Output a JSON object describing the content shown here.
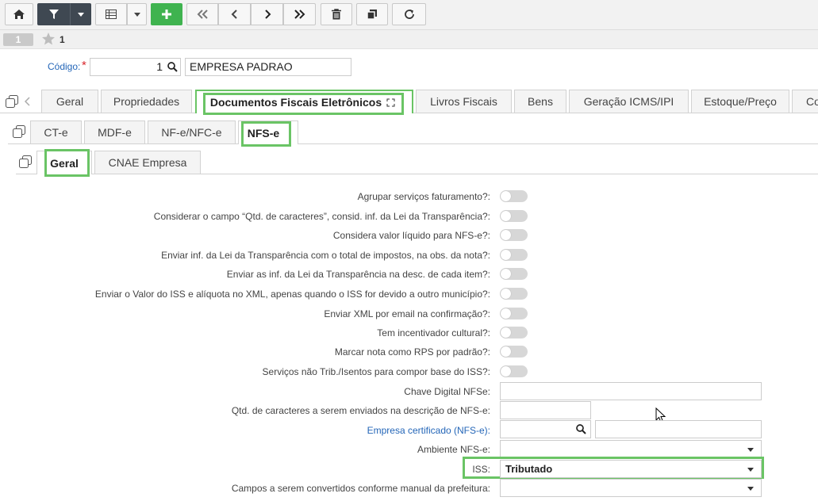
{
  "toolbar": {
    "buttons": [
      "home-icon",
      "filter-icon",
      "dropdown-caret-icon",
      "table-icon",
      "dropdown-caret-icon",
      "plus-icon",
      "first-icon",
      "prev-icon",
      "next-icon",
      "last-icon",
      "trash-icon",
      "copy-icon",
      "refresh-icon"
    ]
  },
  "record": {
    "number": "1",
    "favorites": "1"
  },
  "header": {
    "codigo_label": "Código:",
    "required_mark": "*",
    "codigo_value": "1",
    "empresa_value": "EMPRESA PADRAO"
  },
  "main_tabs": [
    "Geral",
    "Propriedades",
    "Documentos Fiscais Eletrônicos",
    "Livros Fiscais",
    "Bens",
    "Geração ICMS/IPI",
    "Estoque/Preço",
    "Co"
  ],
  "doc_tabs": [
    "CT-e",
    "MDF-e",
    "NF-e/NFC-e",
    "NFS-e"
  ],
  "nfse_tabs": [
    "Geral",
    "CNAE Empresa"
  ],
  "form": {
    "toggles": [
      {
        "label": "Agrupar serviços faturamento?:",
        "value": false
      },
      {
        "label": "Considerar o campo “Qtd. de caracteres”, consid. inf. da Lei da Transparência?:",
        "value": false
      },
      {
        "label": "Considera valor líquido para NFS-e?:",
        "value": false
      },
      {
        "label": "Enviar inf. da Lei da Transparência com o total de impostos, na obs. da nota?:",
        "value": false
      },
      {
        "label": "Enviar as inf. da Lei da Transparência na desc. de cada item?:",
        "value": false
      },
      {
        "label": "Enviar o Valor do ISS e alíquota no XML, apenas quando o ISS for devido a outro município?:",
        "value": false
      },
      {
        "label": "Enviar XML por email na confirmação?:",
        "value": false
      },
      {
        "label": "Tem incentivador cultural?:",
        "value": false
      },
      {
        "label": "Marcar nota como RPS por padrão?:",
        "value": false
      },
      {
        "label": "Serviços não Trib./Isentos para compor base do ISS?:",
        "value": false
      }
    ],
    "chave_label": "Chave Digital NFSe:",
    "chave_value": "",
    "qtd_label": "Qtd. de caracteres a serem enviados na descrição de NFS-e:",
    "qtd_value": "",
    "empresa_cert_label": "Empresa certificado (NFS-e):",
    "ambiente_label": "Ambiente NFS-e:",
    "ambiente_value": "",
    "iss_label": "ISS:",
    "iss_value": "Tributado",
    "campos_label": "Campos a serem convertidos conforme manual da prefeitura:",
    "campos_value": ""
  },
  "colors": {
    "accent_green": "#6ac465",
    "link_blue": "#2466b8",
    "required_red": "#d9262c",
    "toolbar_dark": "#3f4852"
  }
}
